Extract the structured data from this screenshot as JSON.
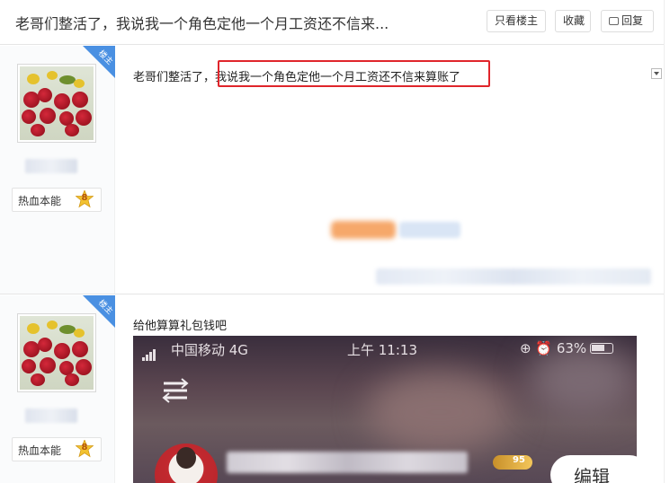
{
  "header": {
    "title": "老哥们整活了，我说我一个角色定他一个月工资还不信来...",
    "buttons": {
      "only_op": "只看楼主",
      "favorite": "收藏",
      "reply": "回复"
    }
  },
  "posts": [
    {
      "badge": "楼主",
      "level_name": "热血本能",
      "level_num": "8",
      "content_prefix": "老哥们整活了，",
      "content_highlight": "我说我一个角色定他一个月工资还不信来算账了"
    },
    {
      "badge": "楼主",
      "level_name": "热血本能",
      "level_num": "8",
      "content": "给他算算礼包钱吧",
      "screenshot": {
        "carrier": "中国移动  4G",
        "time": "上午 11:13",
        "battery": "63%",
        "vip_level": "95",
        "edit_label": "编辑"
      }
    }
  ],
  "colors": {
    "highlight": "#e0252b",
    "badge": "#4a90e2"
  }
}
